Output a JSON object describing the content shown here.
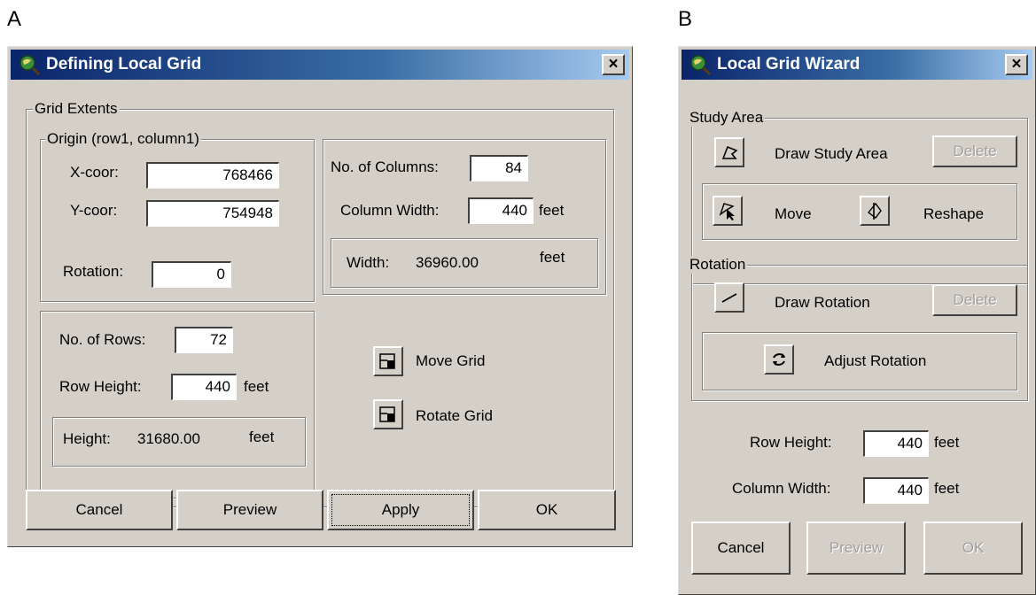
{
  "panel_a": {
    "letter": "A",
    "title": "Defining Local Grid",
    "close": "×",
    "grid_extents": {
      "label": "Grid Extents",
      "origin": {
        "label": "Origin (row1, column1)",
        "x_label": "X-coor:",
        "x_value": "768466",
        "y_label": "Y-coor:",
        "y_value": "754948",
        "rotation_label": "Rotation:",
        "rotation_value": "0"
      },
      "columns": {
        "count_label": "No. of Columns:",
        "count_value": "84",
        "width_label": "Column Width:",
        "width_value": "440",
        "width_unit": "feet",
        "total_label": "Width:",
        "total_value": "36960.00",
        "total_unit": "feet"
      },
      "rows": {
        "count_label": "No. of Rows:",
        "count_value": "72",
        "height_label": "Row Height:",
        "height_value": "440",
        "height_unit": "feet",
        "total_label": "Height:",
        "total_value": "31680.00",
        "total_unit": "feet"
      },
      "move_grid": "Move Grid",
      "rotate_grid": "Rotate Grid"
    },
    "buttons": {
      "cancel": "Cancel",
      "preview": "Preview",
      "apply": "Apply",
      "ok": "OK"
    }
  },
  "panel_b": {
    "letter": "B",
    "title": "Local Grid Wizard",
    "close": "×",
    "study_area": {
      "label": "Study Area",
      "draw": "Draw Study Area",
      "delete": "Delete",
      "move": "Move",
      "reshape": "Reshape"
    },
    "rotation": {
      "label": "Rotation",
      "draw": "Draw Rotation",
      "delete": "Delete",
      "adjust": "Adjust Rotation"
    },
    "row_height_label": "Row Height:",
    "row_height_value": "440",
    "row_height_unit": "feet",
    "column_width_label": "Column Width:",
    "column_width_value": "440",
    "column_width_unit": "feet",
    "buttons": {
      "cancel": "Cancel",
      "preview": "Preview",
      "ok": "OK"
    }
  },
  "colors": {
    "face": "#d4d0c8",
    "title_start": "#0a246a",
    "title_end": "#a6caf0"
  }
}
